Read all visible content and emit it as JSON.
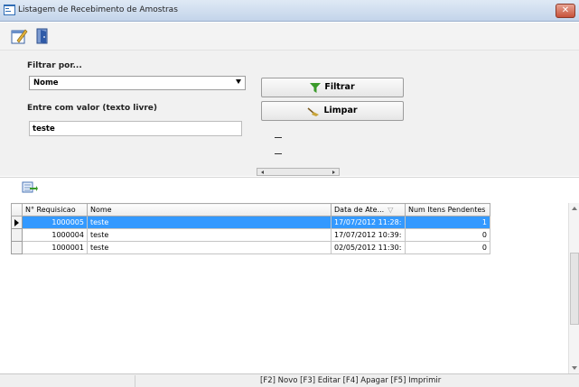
{
  "window": {
    "title": "Listagem de Recebimento de Amostras",
    "close_glyph": "✕"
  },
  "toolbar": {
    "icons": [
      "edit-icon",
      "exit-door-icon"
    ]
  },
  "filter": {
    "section_label": "Filtrar por...",
    "field_select_value": "Nome",
    "free_text_label": "Entre com valor (texto livre)",
    "free_text_value": "teste",
    "filter_button_label": "Filtrar",
    "clear_button_label": "Limpar"
  },
  "grid": {
    "columns": [
      "N° Requisicao",
      "Nome",
      "Data de Ate...",
      "Num Itens Pendentes"
    ],
    "sort_glyph": "▽",
    "rows": [
      {
        "requisicao": "1000005",
        "nome": "teste",
        "data": "17/07/2012 11:28:",
        "pendentes": "1",
        "selected": true
      },
      {
        "requisicao": "1000004",
        "nome": "teste",
        "data": "17/07/2012 10:39:",
        "pendentes": "0",
        "selected": false
      },
      {
        "requisicao": "1000001",
        "nome": "teste",
        "data": "02/05/2012 11:30:",
        "pendentes": "0",
        "selected": false
      }
    ]
  },
  "statusbar": {
    "shortcuts": "[F2] Novo [F3] Editar [F4] Apagar [F5] Imprimir"
  },
  "colors": {
    "selection": "#3399ff",
    "filter_icon": "#3a9a2a",
    "clear_icon": "#c9a53a"
  }
}
